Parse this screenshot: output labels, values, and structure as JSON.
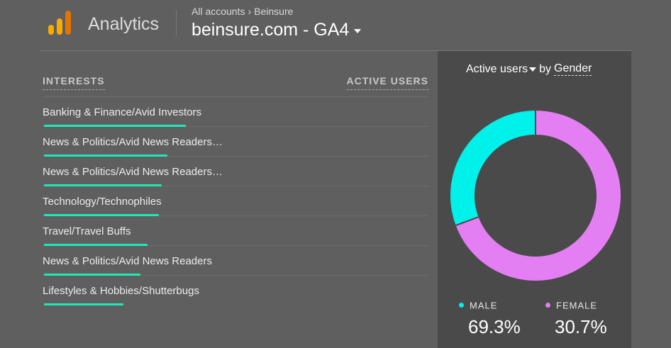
{
  "app": {
    "name": "Analytics"
  },
  "breadcrumb": {
    "items": [
      "All accounts",
      "Beinsure"
    ],
    "separator": "›"
  },
  "property": {
    "name": "beinsure.com - GA4"
  },
  "table": {
    "headers": {
      "dimension": "INTERESTS",
      "metric": "ACTIVE USERS"
    },
    "rows": [
      {
        "label": "Banking & Finance/Avid Investors",
        "value": 1.0
      },
      {
        "label": "News & Politics/Avid News Readers…",
        "value": 0.87
      },
      {
        "label": "News & Politics/Avid News Readers…",
        "value": 0.83
      },
      {
        "label": "Technology/Technophiles",
        "value": 0.81
      },
      {
        "label": "Travel/Travel Buffs",
        "value": 0.73
      },
      {
        "label": "News & Politics/Avid News Readers",
        "value": 0.68
      },
      {
        "label": "Lifestyles & Hobbies/Shutterbugs",
        "value": 0.56
      }
    ]
  },
  "panel": {
    "metric": "Active users",
    "by": "by",
    "dimension": "Gender"
  },
  "chart_data": {
    "type": "pie",
    "categories": [
      "MALE",
      "FEMALE"
    ],
    "labels": [
      "69.3%",
      "30.7%"
    ],
    "slices": [
      {
        "name": "FEMALE",
        "value": 69.3,
        "color": "#e47ef3"
      },
      {
        "name": "MALE",
        "value": 30.7,
        "color": "#00f0ea"
      }
    ],
    "legend": [
      {
        "name": "MALE",
        "value": "69.3%",
        "color": "#00f0ea"
      },
      {
        "name": "FEMALE",
        "value": "30.7%",
        "color": "#e47ef3"
      }
    ],
    "style": "donut"
  },
  "colors": {
    "bar": "#1de9b6",
    "background": "#5f5f5f",
    "panel": "#4a4a4a",
    "logo": [
      "#f9ab00",
      "#e37400"
    ]
  }
}
